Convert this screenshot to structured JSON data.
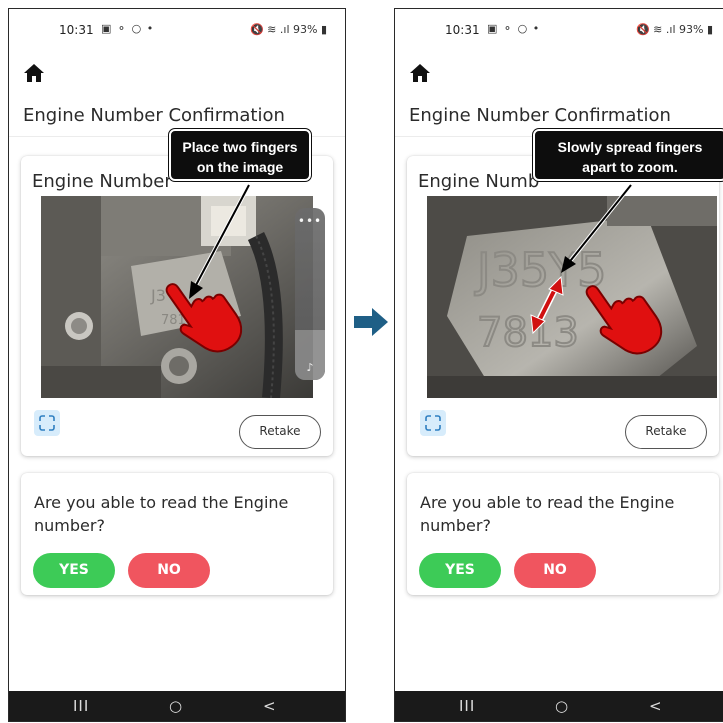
{
  "left_phone": {
    "status": {
      "time": "10:31",
      "notif": "▣ ⚬ ○ •",
      "right": "🔇 ≋ .ıl 93% ▮"
    },
    "app_title": "Engine Number Confirmation",
    "card_label": "Engine Number",
    "callout": {
      "line1": "Place two fingers",
      "line2": "on the image"
    },
    "retake_label": "Retake",
    "question": "Are you able to read the Engine number?",
    "yes_label": "YES",
    "no_label": "NO",
    "nav": {
      "recents": "III",
      "home": "○",
      "back": "<"
    },
    "side_panel": {
      "dots": "•••",
      "note": "♪"
    }
  },
  "right_phone": {
    "status": {
      "time": "10:31",
      "notif": "▣ ⚬ ○ •",
      "right": "🔇 ≋ .ıl 93% ▮"
    },
    "app_title": "Engine Number Confirmation",
    "card_label": "Engine Numb",
    "callout": {
      "line1": "Slowly spread fingers",
      "line2": "apart to zoom."
    },
    "retake_label": "Retake",
    "question": "Are you able to read the Engine number?",
    "yes_label": "YES",
    "no_label": "NO",
    "nav": {
      "recents": "III",
      "home": "○",
      "back": "<"
    },
    "engraving": {
      "line1": "J35Y5",
      "line2": "7813"
    }
  },
  "colors": {
    "accent_yes": "#3dcb57",
    "accent_no": "#f0555f",
    "expand_bg": "#d7ecfb",
    "arrow": "#1f5f86",
    "hand": "#e01010"
  },
  "icons": [
    "home-icon",
    "expand-icon",
    "hand-pointer-icon",
    "transition-arrow-icon",
    "double-arrow-icon"
  ]
}
